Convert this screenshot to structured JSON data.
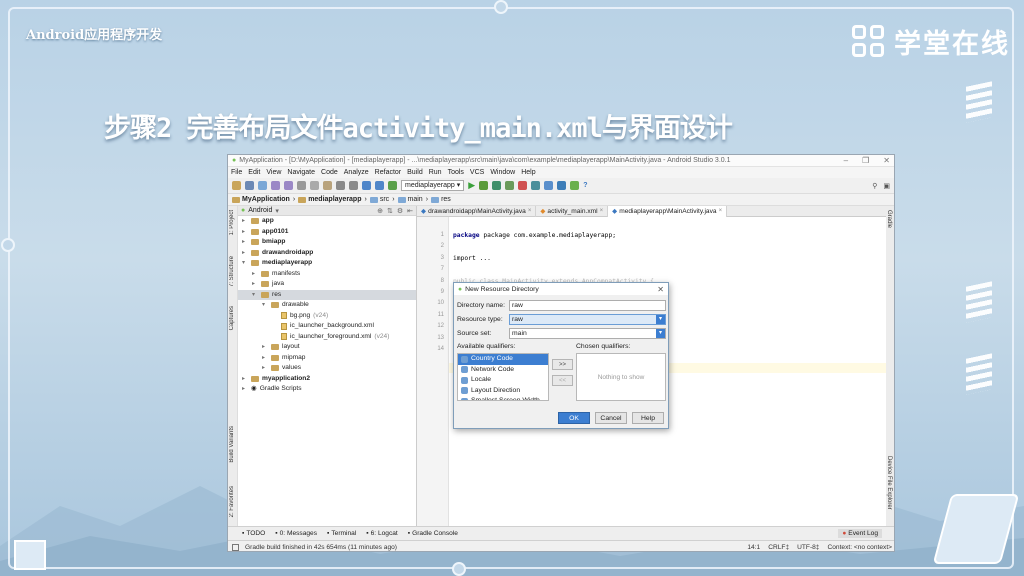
{
  "slide": {
    "course_title": "Android应用程序开发",
    "brand_name": "学堂在线",
    "heading": "步骤2 完善布局文件activity_main.xml与界面设计"
  },
  "ide": {
    "window_title": "MyApplication - [D:\\MyApplication] - [mediaplayerapp] - ...\\mediaplayerapp\\src\\main\\java\\com\\example\\mediaplayerapp\\MainActivity.java - Android Studio 3.0.1",
    "menu": [
      "File",
      "Edit",
      "View",
      "Navigate",
      "Code",
      "Analyze",
      "Refactor",
      "Build",
      "Run",
      "Tools",
      "VCS",
      "Window",
      "Help"
    ],
    "run_config": "mediaplayerapp",
    "breadcrumbs": [
      "MyApplication",
      "mediaplayerapp",
      "src",
      "main",
      "res"
    ],
    "project_view": "Android",
    "tree": [
      {
        "label": "app",
        "bold": true,
        "indent": 0,
        "arrow": "▸",
        "icon": "folder"
      },
      {
        "label": "app0101",
        "bold": true,
        "indent": 0,
        "arrow": "▸",
        "icon": "folder"
      },
      {
        "label": "bmiapp",
        "bold": true,
        "indent": 0,
        "arrow": "▸",
        "icon": "folder"
      },
      {
        "label": "drawandroidapp",
        "bold": true,
        "indent": 0,
        "arrow": "▸",
        "icon": "folder"
      },
      {
        "label": "mediaplayerapp",
        "bold": true,
        "indent": 0,
        "arrow": "▾",
        "icon": "folder"
      },
      {
        "label": "manifests",
        "bold": false,
        "indent": 1,
        "arrow": "▸",
        "icon": "folder"
      },
      {
        "label": "java",
        "bold": false,
        "indent": 1,
        "arrow": "▸",
        "icon": "folder"
      },
      {
        "label": "res",
        "bold": false,
        "indent": 1,
        "arrow": "▾",
        "icon": "folder",
        "selected": true
      },
      {
        "label": "drawable",
        "bold": false,
        "indent": 2,
        "arrow": "▾",
        "icon": "folder"
      },
      {
        "label": "bg.png",
        "suffix": "(v24)",
        "bold": false,
        "indent": 3,
        "arrow": "",
        "icon": "file"
      },
      {
        "label": "ic_launcher_background.xml",
        "bold": false,
        "indent": 3,
        "arrow": "",
        "icon": "file"
      },
      {
        "label": "ic_launcher_foreground.xml",
        "suffix": "(v24)",
        "bold": false,
        "indent": 3,
        "arrow": "",
        "icon": "file"
      },
      {
        "label": "layout",
        "bold": false,
        "indent": 2,
        "arrow": "▸",
        "icon": "folder"
      },
      {
        "label": "mipmap",
        "bold": false,
        "indent": 2,
        "arrow": "▸",
        "icon": "folder"
      },
      {
        "label": "values",
        "bold": false,
        "indent": 2,
        "arrow": "▸",
        "icon": "folder"
      },
      {
        "label": "myapplication2",
        "bold": true,
        "indent": 0,
        "arrow": "▸",
        "icon": "folder"
      },
      {
        "label": "Gradle Scripts",
        "bold": false,
        "indent": 0,
        "arrow": "▸",
        "icon": "gradle"
      }
    ],
    "left_tabs": [
      "1: Project",
      "7: Structure",
      "Captures",
      "Build Variants",
      "2: Favorites"
    ],
    "right_tabs": [
      "Gradle",
      "Device File Explorer"
    ],
    "editor_tabs": [
      {
        "label": "drawandroidapp\\MainActivity.java",
        "active": false
      },
      {
        "label": "activity_main.xml",
        "active": false
      },
      {
        "label": "mediaplayerapp\\MainActivity.java",
        "active": true
      }
    ],
    "code_lines": [
      {
        "num": "1",
        "text": "package com.example.mediaplayerapp;"
      },
      {
        "num": "2",
        "text": ""
      },
      {
        "num": "3",
        "text": "import ..."
      },
      {
        "num": "",
        "text": ""
      },
      {
        "num": "",
        "text": "public class MainActivity extends AppCompatActivity {"
      }
    ],
    "line_numbers": [
      "1",
      "2",
      "3",
      "7",
      "8",
      "9",
      "10",
      "11",
      "12",
      "13",
      "14"
    ],
    "bottom_tabs": [
      "TODO",
      "0: Messages",
      "Terminal",
      "6: Logcat",
      "Gradle Console"
    ],
    "event_log": "Event Log",
    "status_message": "Gradle build finished in 42s 654ms (11 minutes ago)",
    "status_right": [
      "14:1",
      "CRLF‡",
      "UTF-8‡",
      "Context: <no context>"
    ]
  },
  "dialog": {
    "title": "New Resource Directory",
    "directory_name_label": "Directory name:",
    "directory_name": "raw",
    "resource_type_label": "Resource type:",
    "resource_type": "raw",
    "source_set_label": "Source set:",
    "source_set": "main",
    "available_label": "Available qualifiers:",
    "chosen_label": "Chosen qualifiers:",
    "qualifiers": [
      "Country Code",
      "Network Code",
      "Locale",
      "Layout Direction",
      "Smallest Screen Width"
    ],
    "add_btn": ">>",
    "remove_btn": "<<",
    "chosen_empty": "Nothing to show",
    "ok": "OK",
    "cancel": "Cancel",
    "help": "Help"
  },
  "colors": {
    "accent": "#3c7ed1",
    "selection": "#d5d9de",
    "background": "#b9d2e6"
  }
}
